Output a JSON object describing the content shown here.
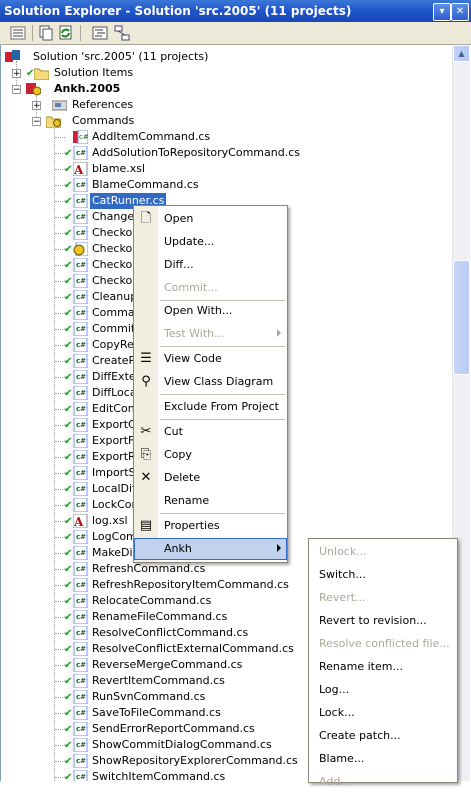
{
  "window": {
    "title": "Solution Explorer - Solution 'src.2005' (11 projects)"
  },
  "toolbar": {
    "buttons": [
      "properties-icon",
      "show-all-files-icon",
      "refresh-icon",
      "view-code-icon",
      "class-diagram-icon"
    ]
  },
  "tree": {
    "solution": "Solution 'src.2005' (11 projects)",
    "solution_items": "Solution Items",
    "project": "Ankh.2005",
    "references": "References",
    "commands": "Commands",
    "files": [
      "AddItemCommand.cs",
      "AddSolutionToRepositoryCommand.cs",
      "blame.xsl",
      "BlameCommand.cs",
      "CatRunner.cs",
      "ChangeA",
      "Checkou",
      "Checkou",
      "Checkou",
      "Checkou",
      "CleanupC",
      "Comman",
      "CommitIt",
      "CopyRep",
      "CreatePa",
      "DiffExter",
      "DiffLocal",
      "EditConf",
      "ExportCo",
      "ExportFo",
      "ExportRe",
      "ImportSo",
      "LocalDiff",
      "LockCom",
      "log.xsl",
      "LogComm",
      "MakeDire",
      "RefreshCommand.cs",
      "RefreshRepositoryItemCommand.cs",
      "RelocateCommand.cs",
      "RenameFileCommand.cs",
      "ResolveConflictCommand.cs",
      "ResolveConflictExternalCommand.cs",
      "ReverseMergeCommand.cs",
      "RevertItemCommand.cs",
      "RunSvnCommand.cs",
      "SaveToFileCommand.cs",
      "SendErrorReportCommand.cs",
      "ShowCommitDialogCommand.cs",
      "ShowRepositoryExplorerCommand.cs",
      "SwitchItemCommand.cs"
    ]
  },
  "context_menu": {
    "items": [
      {
        "label": "Open",
        "icon": "open-icon",
        "enabled": true
      },
      {
        "label": "Update...",
        "enabled": true
      },
      {
        "label": "Diff...",
        "enabled": true
      },
      {
        "label": "Commit...",
        "enabled": false
      },
      {
        "label": "Open With...",
        "enabled": true
      },
      {
        "label": "Test With...",
        "enabled": false,
        "submenu": true
      },
      {
        "label": "View Code",
        "icon": "view-code-icon",
        "enabled": true
      },
      {
        "label": "View Class Diagram",
        "icon": "class-diagram-icon",
        "enabled": true
      },
      {
        "label": "Exclude From Project",
        "enabled": true
      },
      {
        "label": "Cut",
        "icon": "scissors-icon",
        "enabled": true
      },
      {
        "label": "Copy",
        "icon": "copy-icon",
        "enabled": true
      },
      {
        "label": "Delete",
        "icon": "delete-icon",
        "enabled": true
      },
      {
        "label": "Rename",
        "enabled": true
      },
      {
        "label": "Properties",
        "icon": "properties-icon",
        "enabled": true
      },
      {
        "label": "Ankh",
        "enabled": true,
        "submenu": true,
        "highlighted": true
      }
    ]
  },
  "ankh_submenu": {
    "items": [
      {
        "label": "Unlock...",
        "enabled": false
      },
      {
        "label": "Switch...",
        "enabled": true
      },
      {
        "label": "Revert...",
        "enabled": false
      },
      {
        "label": "Revert to revision...",
        "enabled": true
      },
      {
        "label": "Resolve conflicted file...",
        "enabled": false
      },
      {
        "label": "Rename item...",
        "enabled": true
      },
      {
        "label": "Log...",
        "enabled": true
      },
      {
        "label": "Lock...",
        "enabled": true
      },
      {
        "label": "Create patch...",
        "enabled": true
      },
      {
        "label": "Blame...",
        "enabled": true
      },
      {
        "label": "Add...",
        "enabled": false
      }
    ]
  },
  "colors": {
    "title_bar": "#1f54c9",
    "selection": "#316ac5",
    "check": "#14a01e",
    "menu_gutter": "#f1efe2"
  }
}
